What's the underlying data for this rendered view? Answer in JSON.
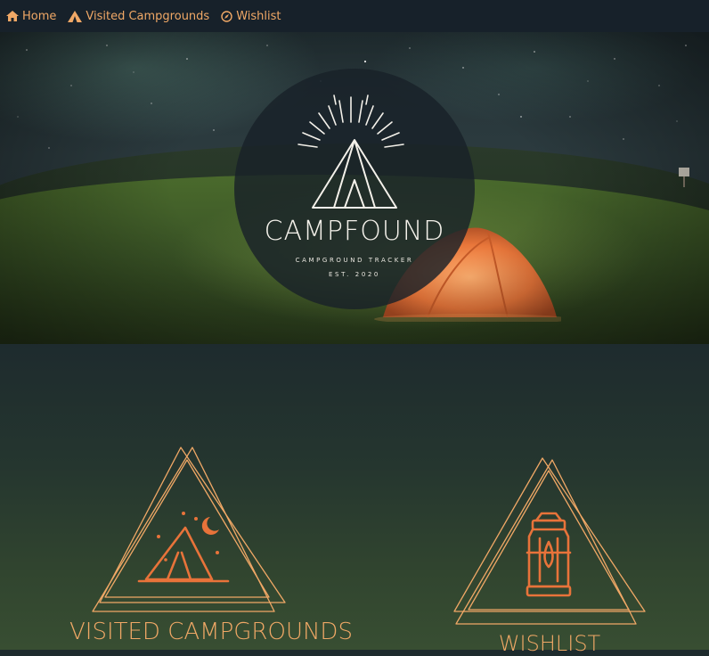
{
  "nav": {
    "items": [
      {
        "label": "Home",
        "icon": "home-icon"
      },
      {
        "label": "Visited Campgrounds",
        "icon": "tent-icon"
      },
      {
        "label": "Wishlist",
        "icon": "compass-icon"
      }
    ]
  },
  "hero": {
    "brand": "CAMPFOUND",
    "tagline": "CAMPGROUND TRACKER",
    "est": "EST. 2020"
  },
  "cards": [
    {
      "title": "VISITED CAMPGROUNDS",
      "icon": "campfire-tent-icon"
    },
    {
      "title": "WISHLIST",
      "icon": "lantern-icon"
    }
  ],
  "colors": {
    "accent": "#f0a866",
    "icon_orange": "#e8733a",
    "nav_bg": "#17212a",
    "logo_bg": "#182128"
  }
}
